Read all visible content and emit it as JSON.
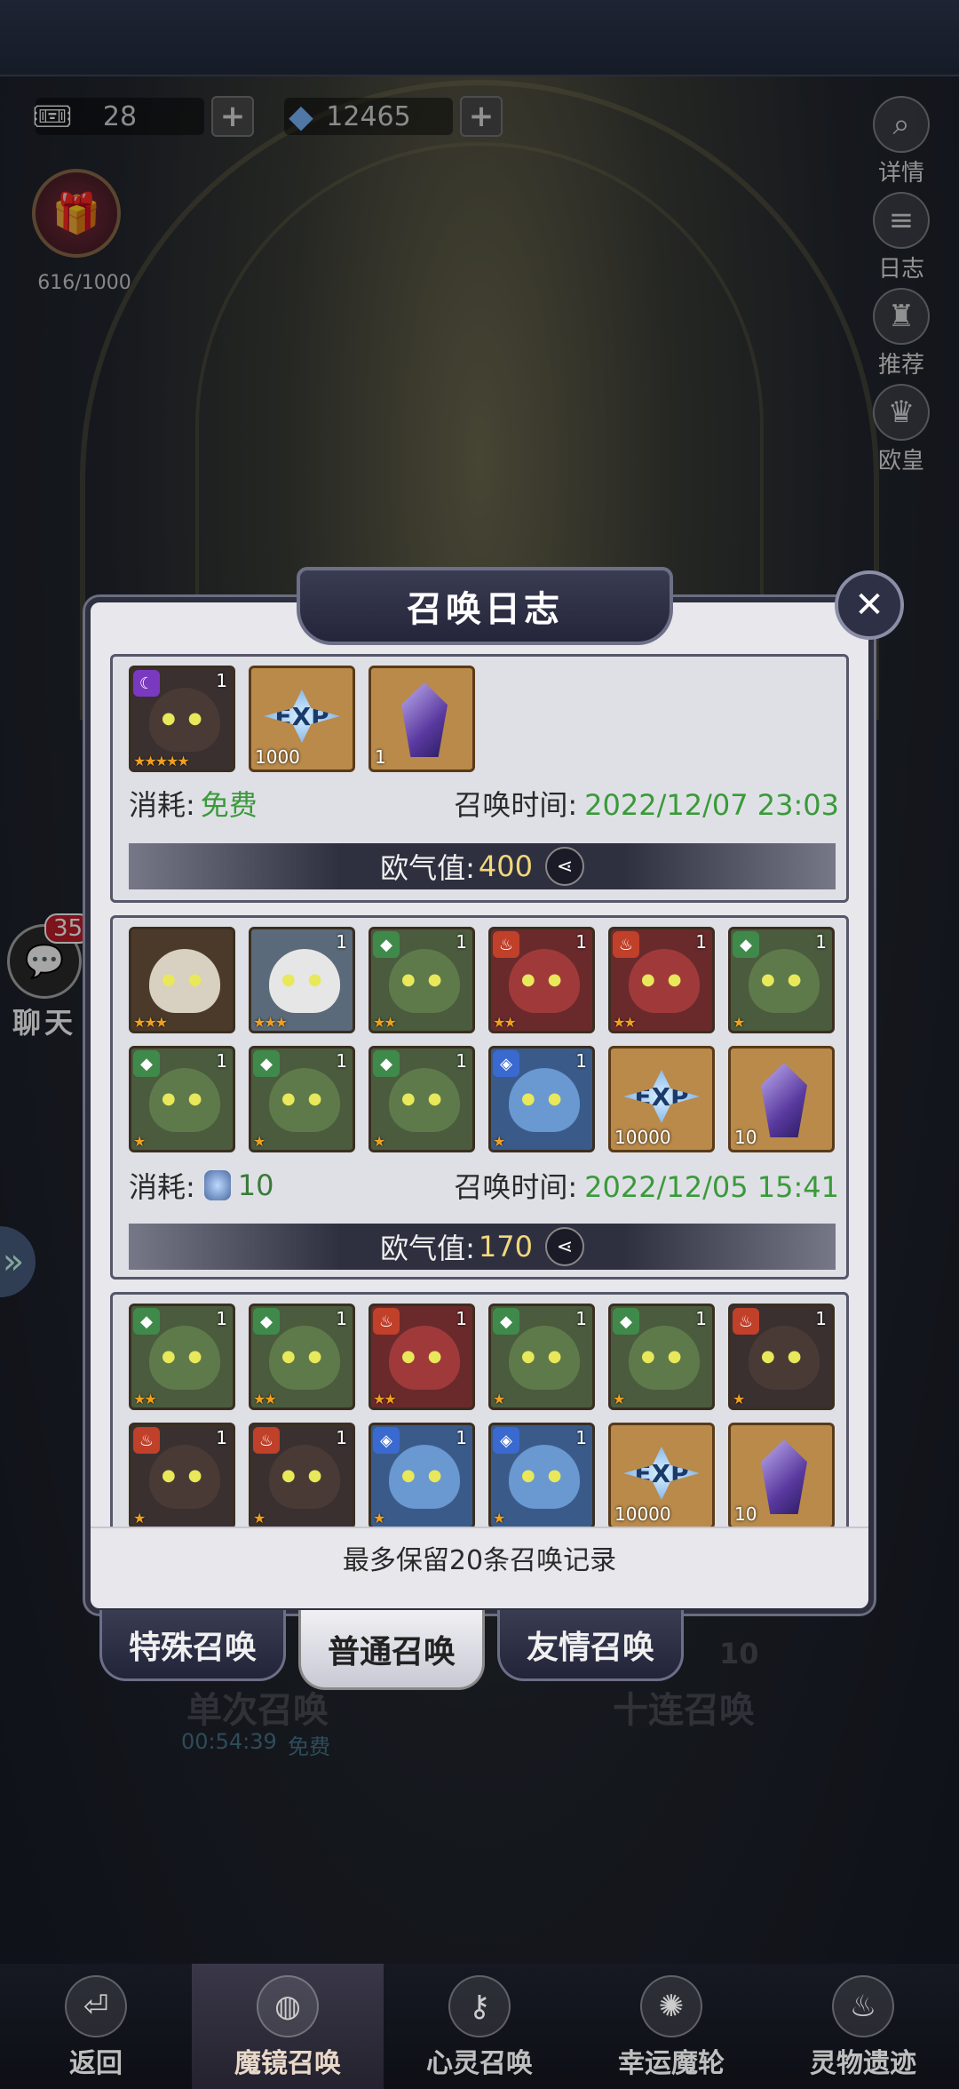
{
  "resources": {
    "tickets": "28",
    "diamonds": "12465",
    "chest_progress": "616/1000"
  },
  "side_menu": [
    {
      "label": "详情",
      "icon": "magnifier-icon"
    },
    {
      "label": "日志",
      "icon": "scroll-icon"
    },
    {
      "label": "推荐",
      "icon": "chess-piece-icon"
    },
    {
      "label": "欧皇",
      "icon": "crown-icon"
    }
  ],
  "chat": {
    "label": "聊天",
    "badge": "35"
  },
  "dialog": {
    "title": "召唤日志",
    "footer_note": "最多保留20条召唤记录",
    "entries": [
      {
        "cost_label": "消耗:",
        "cost_value": "免费",
        "time_label": "召唤时间:",
        "time": "2022/12/07 23:03",
        "luck_label": "欧气值:",
        "luck_value": "400",
        "items": [
          {
            "type": "hero",
            "color": "d",
            "elem": "v",
            "count": "1",
            "stars": 5
          },
          {
            "type": "exp",
            "count": "1000"
          },
          {
            "type": "gem",
            "count": "1"
          }
        ]
      },
      {
        "cost_label": "消耗:",
        "cost_value": "10",
        "time_label": "召唤时间:",
        "time": "2022/12/05 15:41",
        "luck_label": "欧气值:",
        "luck_value": "170",
        "items": [
          {
            "type": "hero",
            "color": "p",
            "elem": "",
            "count": "",
            "stars": 3
          },
          {
            "type": "hero",
            "color": "w",
            "elem": "",
            "count": "1",
            "stars": 3
          },
          {
            "type": "hero",
            "color": "h",
            "elem": "g",
            "count": "1",
            "stars": 2
          },
          {
            "type": "hero",
            "color": "r",
            "elem": "f",
            "count": "1",
            "stars": 2
          },
          {
            "type": "hero",
            "color": "r",
            "elem": "f",
            "count": "1",
            "stars": 2
          },
          {
            "type": "hero",
            "color": "h",
            "elem": "g",
            "count": "1",
            "stars": 1
          },
          {
            "type": "hero",
            "color": "h",
            "elem": "g",
            "count": "1",
            "stars": 1
          },
          {
            "type": "hero",
            "color": "h",
            "elem": "g",
            "count": "1",
            "stars": 1
          },
          {
            "type": "hero",
            "color": "h",
            "elem": "g",
            "count": "1",
            "stars": 1
          },
          {
            "type": "hero",
            "color": "b",
            "elem": "w",
            "count": "1",
            "stars": 1
          },
          {
            "type": "exp",
            "count": "10000"
          },
          {
            "type": "gem",
            "count": "10"
          }
        ]
      },
      {
        "items": [
          {
            "type": "hero",
            "color": "h",
            "elem": "g",
            "count": "1",
            "stars": 2
          },
          {
            "type": "hero",
            "color": "h",
            "elem": "g",
            "count": "1",
            "stars": 2
          },
          {
            "type": "hero",
            "color": "r",
            "elem": "f",
            "count": "1",
            "stars": 2
          },
          {
            "type": "hero",
            "color": "h",
            "elem": "g",
            "count": "1",
            "stars": 1
          },
          {
            "type": "hero",
            "color": "h",
            "elem": "g",
            "count": "1",
            "stars": 1
          },
          {
            "type": "hero",
            "color": "d",
            "elem": "f",
            "count": "1",
            "stars": 1
          },
          {
            "type": "hero",
            "color": "d",
            "elem": "f",
            "count": "1",
            "stars": 1
          },
          {
            "type": "hero",
            "color": "d",
            "elem": "f",
            "count": "1",
            "stars": 1
          },
          {
            "type": "hero",
            "color": "b",
            "elem": "w",
            "count": "1",
            "stars": 1
          },
          {
            "type": "hero",
            "color": "b",
            "elem": "w",
            "count": "1",
            "stars": 1
          },
          {
            "type": "exp",
            "count": "10000"
          },
          {
            "type": "gem",
            "count": "10"
          }
        ]
      }
    ]
  },
  "tabs": [
    {
      "label": "特殊召唤",
      "active": false
    },
    {
      "label": "普通召唤",
      "active": true
    },
    {
      "label": "友情召唤",
      "active": false
    }
  ],
  "background_buttons": {
    "single": "单次召唤",
    "single_timer": "00:54:39",
    "single_free": "免费",
    "ten": "十连召唤",
    "ten_cost": "10"
  },
  "bottom_nav": [
    {
      "label": "返回",
      "icon": "return-icon",
      "active": false
    },
    {
      "label": "魔镜召唤",
      "icon": "mirror-icon",
      "active": true
    },
    {
      "label": "心灵召唤",
      "icon": "keyhole-icon",
      "active": false
    },
    {
      "label": "幸运魔轮",
      "icon": "wheel-icon",
      "active": false
    },
    {
      "label": "灵物遗迹",
      "icon": "flame-icon",
      "active": false
    }
  ],
  "colors": {
    "green_text": "#3a9a3a",
    "luck_value": "#f2d87a",
    "dialog_bg": "#e7e7ec"
  }
}
